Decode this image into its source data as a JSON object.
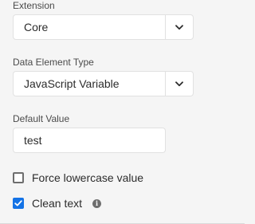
{
  "extension": {
    "label": "Extension",
    "value": "Core"
  },
  "data_element_type": {
    "label": "Data Element Type",
    "value": "JavaScript Variable"
  },
  "default_value": {
    "label": "Default Value",
    "value": "test"
  },
  "options": {
    "force_lowercase": {
      "label": "Force lowercase value",
      "checked": false
    },
    "clean_text": {
      "label": "Clean text",
      "checked": true,
      "info_icon": "info-icon"
    }
  },
  "colors": {
    "accent": "#1473e6",
    "background": "#f5f5f5",
    "field": "#ffffff",
    "border": "#e1e1e1"
  }
}
